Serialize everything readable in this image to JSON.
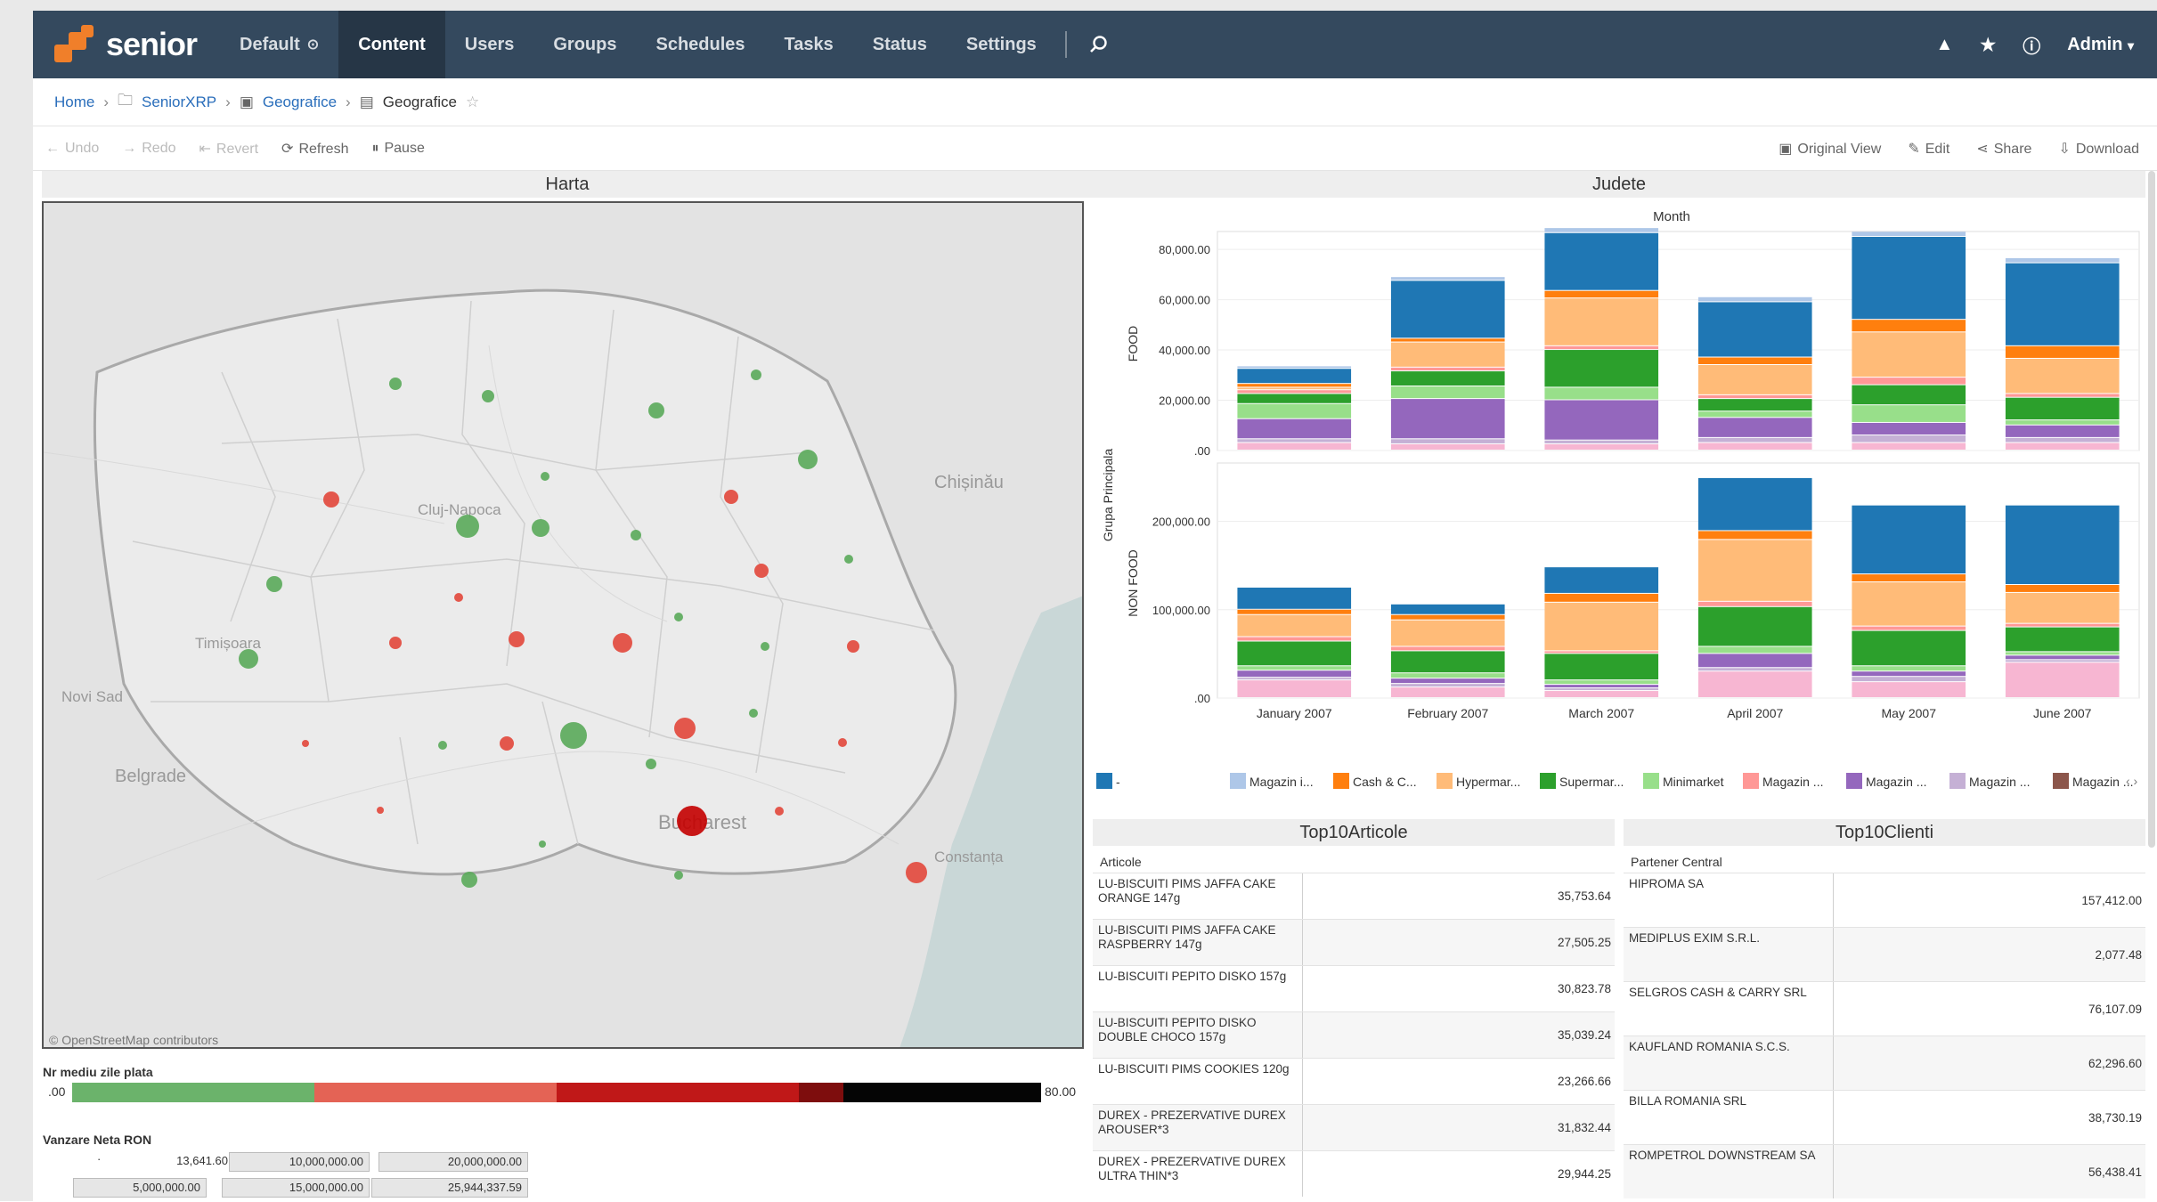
{
  "nav": {
    "logo_text": "senior",
    "items": [
      "Default",
      "Content",
      "Users",
      "Groups",
      "Schedules",
      "Tasks",
      "Status",
      "Settings"
    ],
    "active": "Content",
    "user": "Admin"
  },
  "breadcrumb": {
    "home": "Home",
    "project": "SeniorXRP",
    "workbook": "Geografice",
    "view": "Geografice"
  },
  "toolbar": {
    "undo": "Undo",
    "redo": "Redo",
    "revert": "Revert",
    "refresh": "Refresh",
    "pause": "Pause",
    "original_view": "Original View",
    "edit": "Edit",
    "share": "Share",
    "download": "Download"
  },
  "map": {
    "title": "Harta",
    "attribution": "© OpenStreetMap contributors",
    "labels": [
      "Cluj-Napoca",
      "Chișinău",
      "Timișoara",
      "Novi Sad",
      "Belgrade",
      "Bucharest",
      "Constanța"
    ],
    "legend_color_title": "Nr mediu zile plata",
    "legend_color_min": ".00",
    "legend_color_max": "80.00",
    "legend_size_title": "Vanzare Neta RON",
    "size_values": [
      "13,641.60",
      "10,000,000.00",
      "20,000,000.00",
      "5,000,000.00",
      "15,000,000.00",
      "25,944,337.59"
    ]
  },
  "colors": {
    "nav_bg": "#34495e",
    "green": "#5aaa5a",
    "red": "#e2473b",
    "dark_red": "#c40000"
  },
  "chart_data": {
    "type": "bar",
    "title": "Judete",
    "column_header": "Month",
    "row_header": "Grupa Principala",
    "categories": [
      "January 2007",
      "February 2007",
      "March 2007",
      "April 2007",
      "May 2007",
      "June 2007"
    ],
    "panels": [
      {
        "name": "FOOD",
        "ticks": [
          "80,000.00",
          "60,000.00",
          "40,000.00",
          "20,000.00",
          ".00"
        ],
        "ylim": [
          0,
          85000
        ],
        "stacks": [
          [
            3000,
            1500,
            8000,
            6000,
            4000,
            1500,
            1000,
            1500,
            6000,
            1000
          ],
          [
            2500,
            2000,
            16000,
            5000,
            6000,
            1500,
            10000,
            1500,
            23000,
            1500
          ],
          [
            2500,
            1500,
            16000,
            5000,
            15000,
            1500,
            19000,
            3000,
            23000,
            2000
          ],
          [
            3000,
            2000,
            8000,
            2500,
            5000,
            1500,
            12000,
            3000,
            22000,
            2000
          ],
          [
            3000,
            3000,
            5000,
            7000,
            8000,
            3000,
            18000,
            5000,
            33000,
            2000
          ],
          [
            3000,
            2000,
            5000,
            2000,
            9000,
            1500,
            14000,
            5000,
            33000,
            2000
          ]
        ]
      },
      {
        "name": "NON FOOD",
        "ticks": [
          "200,000.00",
          "100,000.00",
          ".00"
        ],
        "ylim": [
          0,
          260000
        ],
        "stacks": [
          [
            20000,
            3000,
            8000,
            5000,
            28000,
            5000,
            25000,
            6000,
            25000,
            0
          ],
          [
            12000,
            4000,
            6000,
            6000,
            25000,
            5000,
            30000,
            6000,
            12000,
            0
          ],
          [
            8000,
            3000,
            4000,
            5000,
            30000,
            3000,
            55000,
            10000,
            30000,
            0
          ],
          [
            30000,
            4000,
            16000,
            8000,
            45000,
            6000,
            70000,
            10000,
            60000,
            0
          ],
          [
            18000,
            6000,
            6000,
            6000,
            40000,
            5000,
            50000,
            9000,
            78000,
            0
          ],
          [
            40000,
            3000,
            5000,
            4000,
            28000,
            4000,
            35000,
            9000,
            90000,
            0
          ]
        ]
      }
    ],
    "legend": [
      {
        "name": "-",
        "color": "#1f77b4"
      },
      {
        "name": "Magazin i...",
        "color": "#aec7e8"
      },
      {
        "name": "Cash & C...",
        "color": "#ff7f0e"
      },
      {
        "name": "Hypermar...",
        "color": "#ffbb78"
      },
      {
        "name": "Supermar...",
        "color": "#2ca02c"
      },
      {
        "name": "Minimarket",
        "color": "#98df8a"
      },
      {
        "name": "Magazin ...",
        "color": "#ff9896"
      },
      {
        "name": "Magazin ...",
        "color": "#9467bd"
      },
      {
        "name": "Magazin ...",
        "color": "#c5b0d5"
      },
      {
        "name": "Magazin ...",
        "color": "#8c564b"
      }
    ],
    "stack_colors": [
      "#f7b6d2",
      "#c5b0d5",
      "#9467bd",
      "#98df8a",
      "#2ca02c",
      "#ff9896",
      "#ffbb78",
      "#ff7f0e",
      "#1f77b4",
      "#aec7e8"
    ]
  },
  "top_articles": {
    "title": "Top10Articole",
    "column": "Articole",
    "rows": [
      {
        "name": "LU-BISCUITI PIMS JAFFA CAKE ORANGE 147g",
        "value": "35,753.64"
      },
      {
        "name": "LU-BISCUITI PIMS JAFFA CAKE RASPBERRY 147g",
        "value": "27,505.25"
      },
      {
        "name": "LU-BISCUITI PEPITO DISKO 157g",
        "value": "30,823.78"
      },
      {
        "name": "LU-BISCUITI PEPITO DISKO DOUBLE CHOCO 157g",
        "value": "35,039.24"
      },
      {
        "name": "LU-BISCUITI PIMS COOKIES 120g",
        "value": "23,266.66"
      },
      {
        "name": "DUREX - PREZERVATIVE DUREX AROUSER*3",
        "value": "31,832.44"
      },
      {
        "name": "DUREX - PREZERVATIVE DUREX ULTRA THIN*3",
        "value": "29,944.25"
      }
    ]
  },
  "top_clients": {
    "title": "Top10Clienti",
    "column": "Partener Central",
    "rows": [
      {
        "name": "HIPROMA SA",
        "value": "157,412.00"
      },
      {
        "name": "MEDIPLUS EXIM S.R.L.",
        "value": "2,077.48"
      },
      {
        "name": "SELGROS CASH & CARRY SRL",
        "value": "76,107.09"
      },
      {
        "name": "KAUFLAND ROMANIA S.C.S.",
        "value": "62,296.60"
      },
      {
        "name": "BILLA ROMANIA SRL",
        "value": "38,730.19"
      },
      {
        "name": "ROMPETROL DOWNSTREAM SA",
        "value": "56,438.41"
      }
    ]
  }
}
